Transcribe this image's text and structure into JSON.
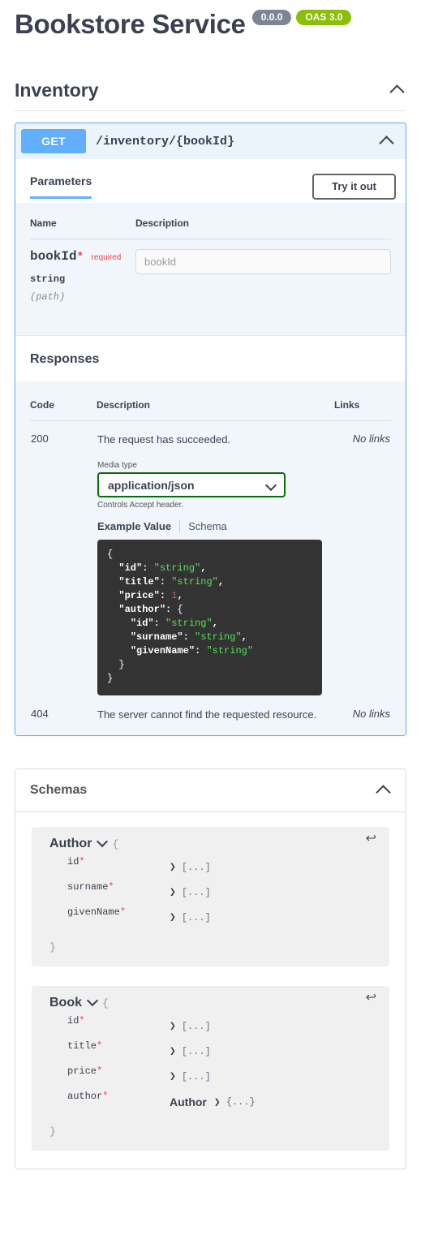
{
  "header": {
    "title": "Bookstore Service",
    "version_badge": "0.0.0",
    "oas_badge": "OAS 3.0"
  },
  "tag": {
    "name": "Inventory",
    "collapse_icon": "chevron-up-icon"
  },
  "operation": {
    "method": "GET",
    "path": "/inventory/{bookId}",
    "collapse_icon": "chevron-up-icon",
    "tabs": {
      "parameters_label": "Parameters",
      "try_it_out_label": "Try it out"
    },
    "parameters": {
      "headers": [
        "Name",
        "Description"
      ],
      "rows": [
        {
          "name": "bookId",
          "required_star": "*",
          "required_label": "required",
          "type": "string",
          "location": "(path)",
          "input_placeholder": "bookId",
          "input_value": ""
        }
      ]
    },
    "responses": {
      "section_title": "Responses",
      "headers": [
        "Code",
        "Description",
        "Links"
      ],
      "rows": [
        {
          "code": "200",
          "description": "The request has succeeded.",
          "links": "No links"
        },
        {
          "code": "404",
          "description": "The server cannot find the requested resource.",
          "links": "No links"
        }
      ],
      "media_type": {
        "label": "Media type",
        "selected": "application/json",
        "hint": "Controls Accept header.",
        "caret_icon": "chevron-down-icon"
      },
      "example_tabs": {
        "example_value": "Example Value",
        "schema": "Schema"
      },
      "example_json": [
        {
          "indent": 0,
          "parts": [
            {
              "t": "{",
              "c": "brace"
            }
          ]
        },
        {
          "indent": 1,
          "parts": [
            {
              "t": "\"id\"",
              "c": "key"
            },
            {
              "t": ": ",
              "c": "plain"
            },
            {
              "t": "\"string\"",
              "c": "str"
            },
            {
              "t": ",",
              "c": "plain"
            }
          ]
        },
        {
          "indent": 1,
          "parts": [
            {
              "t": "\"title\"",
              "c": "key"
            },
            {
              "t": ": ",
              "c": "plain"
            },
            {
              "t": "\"string\"",
              "c": "str"
            },
            {
              "t": ",",
              "c": "plain"
            }
          ]
        },
        {
          "indent": 1,
          "parts": [
            {
              "t": "\"price\"",
              "c": "key"
            },
            {
              "t": ": ",
              "c": "plain"
            },
            {
              "t": "1",
              "c": "num"
            },
            {
              "t": ",",
              "c": "plain"
            }
          ]
        },
        {
          "indent": 1,
          "parts": [
            {
              "t": "\"author\"",
              "c": "key"
            },
            {
              "t": ": ",
              "c": "plain"
            },
            {
              "t": "{",
              "c": "brace"
            }
          ]
        },
        {
          "indent": 2,
          "parts": [
            {
              "t": "\"id\"",
              "c": "key"
            },
            {
              "t": ": ",
              "c": "plain"
            },
            {
              "t": "\"string\"",
              "c": "str"
            },
            {
              "t": ",",
              "c": "plain"
            }
          ]
        },
        {
          "indent": 2,
          "parts": [
            {
              "t": "\"surname\"",
              "c": "key"
            },
            {
              "t": ": ",
              "c": "plain"
            },
            {
              "t": "\"string\"",
              "c": "str"
            },
            {
              "t": ",",
              "c": "plain"
            }
          ]
        },
        {
          "indent": 2,
          "parts": [
            {
              "t": "\"givenName\"",
              "c": "key"
            },
            {
              "t": ": ",
              "c": "plain"
            },
            {
              "t": "\"string\"",
              "c": "str"
            }
          ]
        },
        {
          "indent": 1,
          "parts": [
            {
              "t": "}",
              "c": "brace"
            }
          ]
        },
        {
          "indent": 0,
          "parts": [
            {
              "t": "}",
              "c": "brace"
            }
          ]
        }
      ]
    }
  },
  "schemas": {
    "title": "Schemas",
    "collapse_icon": "chevron-up-icon",
    "models": [
      {
        "name": "Author",
        "toggle_icon": "chevron-down-icon",
        "back_icon": "return-arrow-icon",
        "open_brace": "{",
        "close_brace": "}",
        "properties": [
          {
            "name": "id",
            "star": "*",
            "ref": "",
            "arrow": "❯",
            "value": "[...]"
          },
          {
            "name": "surname",
            "star": "*",
            "ref": "",
            "arrow": "❯",
            "value": "[...]"
          },
          {
            "name": "givenName",
            "star": "*",
            "ref": "",
            "arrow": "❯",
            "value": "[...]"
          }
        ]
      },
      {
        "name": "Book",
        "toggle_icon": "chevron-down-icon",
        "back_icon": "return-arrow-icon",
        "open_brace": "{",
        "close_brace": "}",
        "properties": [
          {
            "name": "id",
            "star": "*",
            "ref": "",
            "arrow": "❯",
            "value": "[...]"
          },
          {
            "name": "title",
            "star": "*",
            "ref": "",
            "arrow": "❯",
            "value": "[...]"
          },
          {
            "name": "price",
            "star": "*",
            "ref": "",
            "arrow": "❯",
            "value": "[...]"
          },
          {
            "name": "author",
            "star": "*",
            "ref": "Author",
            "arrow": "❯",
            "value": "{...}"
          }
        ]
      }
    ]
  },
  "colors": {
    "get_method": "#61affe",
    "oas_badge": "#89bf04",
    "version_badge": "#7d8492",
    "required": "#f93e3e",
    "select_border": "#0a6b0a",
    "code_bg": "#333333",
    "string_green": "#55e05a",
    "number_red": "#bf5a5a"
  }
}
